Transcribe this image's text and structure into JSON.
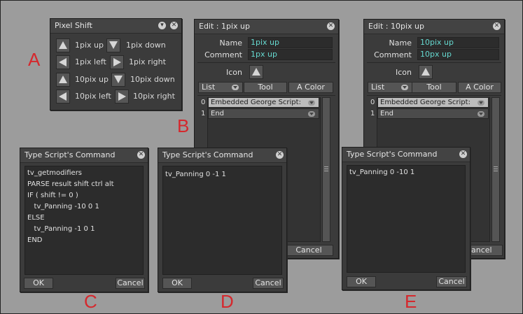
{
  "letters": [
    "A",
    "B",
    "C",
    "D",
    "E"
  ],
  "pixel_shift": {
    "title": "Pixel Shift",
    "labels": [
      "1pix up",
      "1pix down",
      "1pix left",
      "1pix right",
      "10pix up",
      "10pix down",
      "10pix left",
      "10pix right"
    ]
  },
  "edit1": {
    "title": "Edit : 1pix up",
    "name_label": "Name",
    "name_value": "1pix up",
    "comment_label": "Comment",
    "comment_value": "1px up",
    "icon_label": "Icon",
    "list_btn": "List",
    "tool_btn": "Tool",
    "color_btn": "A Color",
    "rows": [
      {
        "num": "0",
        "text": "Embedded George Script:"
      },
      {
        "num": "1",
        "text": "End"
      }
    ],
    "cancel": "Cancel"
  },
  "edit2": {
    "title": "Edit : 10pix up",
    "name_label": "Name",
    "name_value": "10pix up",
    "comment_label": "Comment",
    "comment_value": "10px up",
    "icon_label": "Icon",
    "list_btn": "List",
    "tool_btn": "Tool",
    "color_btn": "A Color",
    "rows": [
      {
        "num": "0",
        "text": "Embedded George Script:"
      },
      {
        "num": "1",
        "text": "End"
      }
    ],
    "cancel": "ancel"
  },
  "script_c": {
    "title": "Type Script's Command",
    "lines": [
      "tv_getmodifiers",
      "PARSE result shift ctrl alt",
      "IF ( shift != 0 )",
      "   tv_Panning -10 0 1",
      "ELSE",
      "   tv_Panning -1 0 1",
      "END"
    ],
    "ok": "OK",
    "cancel": "Cancel"
  },
  "script_d": {
    "title": "Type Script's Command",
    "lines": [
      "tv_Panning 0 -1 1"
    ],
    "ok": "OK",
    "cancel": "Cancel"
  },
  "script_e": {
    "title": "Type Script's Command",
    "lines": [
      "tv_Panning 0 -10 1"
    ],
    "ok": "OK",
    "cancel": "Cancel"
  }
}
